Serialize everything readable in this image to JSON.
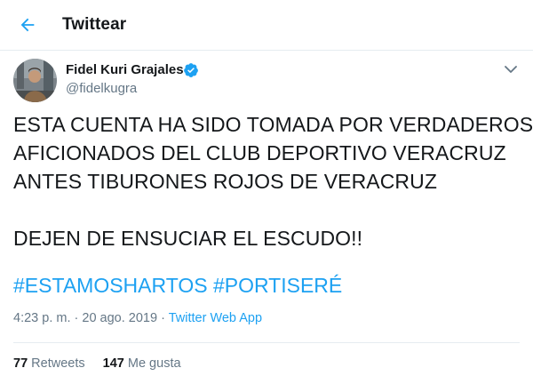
{
  "header": {
    "back_icon": "arrow-left-icon",
    "title": "Twittear"
  },
  "user": {
    "display_name": "Fidel Kuri Grajales",
    "handle": "@fidelkugra",
    "verified_icon": "verified-badge-icon"
  },
  "tweet": {
    "lines": [
      "ESTA CUENTA HA SIDO TOMADA POR VERDADEROS",
      "AFICIONADOS DEL CLUB DEPORTIVO VERACRUZ",
      "ANTES TIBURONES ROJOS DE VERACRUZ",
      "DEJEN DE ENSUCIAR EL ESCUDO!!"
    ],
    "hashtags": [
      "#ESTAMOSHARTOS",
      "#PORTISERÉ"
    ]
  },
  "meta": {
    "time": "4:23 p. m.",
    "separator": "·",
    "date": "20 ago. 2019",
    "app": "Twitter Web App"
  },
  "stats": {
    "retweets_count": "77",
    "retweets_label": "Retweets",
    "likes_count": "147",
    "likes_label": "Me gusta"
  },
  "colors": {
    "accent": "#1da1f2",
    "text": "#14171a",
    "secondary": "#657786",
    "border": "#e6ecf0"
  }
}
